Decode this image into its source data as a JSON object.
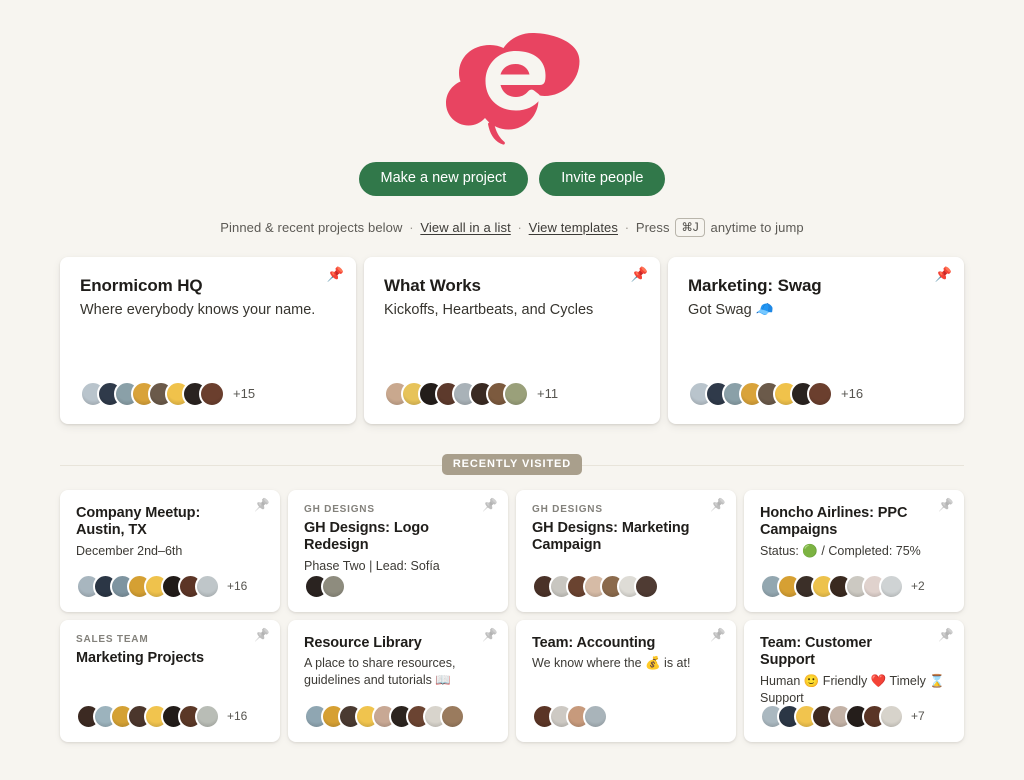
{
  "brand": {
    "logo_icon": "cloud-e-logo",
    "logo_color": "#e84461",
    "accent_green": "#31784a",
    "badge_color": "#a99f8c",
    "background": "#f7f5f0"
  },
  "hero": {
    "primary_button": "Make a new project",
    "secondary_button": "Invite people",
    "subline": {
      "lead": "Pinned & recent projects below",
      "link_list": "View all in a list",
      "link_templates": "View templates",
      "press": "Press",
      "shortcut": "⌘J",
      "tail": "anytime to jump",
      "separator": "·"
    }
  },
  "pinned": {
    "pin_icon": "pushpin-icon",
    "cards": [
      {
        "title": "Enormicom HQ",
        "subtitle": "Where everybody knows your name.",
        "pinned": true,
        "avatar_count": 8,
        "more": "+15",
        "avatar_colors": [
          "#b9c4cc",
          "#2f3a4a",
          "#8aa0a8",
          "#d9a33a",
          "#6b5a4a",
          "#f0c24b",
          "#2a2320",
          "#6b3f2e"
        ]
      },
      {
        "title": "What Works",
        "subtitle": "Kickoffs, Heartbeats, and Cycles",
        "pinned": true,
        "avatar_count": 8,
        "more": "+11",
        "avatar_colors": [
          "#c9a88e",
          "#e7c35a",
          "#231d1a",
          "#5d3a2c",
          "#a9b2b8",
          "#3a2a22",
          "#7c5a3e",
          "#9aa07a"
        ]
      },
      {
        "title": "Marketing: Swag",
        "subtitle": "Got Swag 🧢",
        "pinned": true,
        "avatar_count": 8,
        "more": "+16",
        "avatar_colors": [
          "#b9c4cc",
          "#2f3a4a",
          "#8aa0a8",
          "#d9a33a",
          "#6b5a4a",
          "#f0c24b",
          "#2a2320",
          "#6b3f2e"
        ]
      }
    ]
  },
  "section": {
    "badge": "RECENTLY VISITED"
  },
  "recent": {
    "pin_icon": "pushpin-icon",
    "cards": [
      {
        "eyebrow": "",
        "title": "Company Meetup: Austin, TX",
        "subtitle": "December 2nd–6th",
        "pinned": false,
        "avatar_count": 8,
        "more": "+16",
        "avatar_colors": [
          "#a8b6bf",
          "#2b3645",
          "#7e94a0",
          "#d5a033",
          "#efc24c",
          "#211b18",
          "#5c3526",
          "#bfc6c9"
        ]
      },
      {
        "eyebrow": "GH DESIGNS",
        "title": "GH Designs: Logo Redesign",
        "subtitle": "Phase Two | Lead: Sofía",
        "pinned": false,
        "avatar_count": 2,
        "more": "",
        "avatar_colors": [
          "#2a2320",
          "#8e8c7e"
        ]
      },
      {
        "eyebrow": "GH DESIGNS",
        "title": "GH Designs: Marketing Campaign",
        "subtitle": "",
        "pinned": false,
        "avatar_count": 7,
        "more": "",
        "avatar_colors": [
          "#4a3228",
          "#c8c6c0",
          "#6a4330",
          "#d6bba6",
          "#8b6a4c",
          "#dedcd6",
          "#4f3b33"
        ]
      },
      {
        "eyebrow": "",
        "title": "Honcho Airlines: PPC Campaigns",
        "subtitle": "Status: 🟢 / Completed: 75%",
        "pinned": false,
        "avatar_count": 8,
        "more": "+2",
        "avatar_colors": [
          "#93a7b0",
          "#d6a033",
          "#3b2f28",
          "#edc24c",
          "#3a2a20",
          "#ccc9c2",
          "#e0d2cd",
          "#cfd3d4"
        ]
      },
      {
        "eyebrow": "SALES TEAM",
        "title": "Marketing Projects",
        "subtitle": "",
        "pinned": false,
        "avatar_count": 8,
        "more": "+16",
        "avatar_colors": [
          "#3c2a22",
          "#9cb3bd",
          "#d4a134",
          "#4b362c",
          "#f1c44e",
          "#221c19",
          "#5b3827",
          "#b9bdb6"
        ]
      },
      {
        "eyebrow": "",
        "title": "Resource Library",
        "subtitle": "A place to share resources, guidelines and tutorials 📖",
        "pinned": false,
        "avatar_count": 9,
        "more": "",
        "avatar_colors": [
          "#8fa6b2",
          "#d6a033",
          "#4a3a31",
          "#f0c44e",
          "#c8a894",
          "#2c241f",
          "#6b4432",
          "#d8d4cc",
          "#9a7b5e"
        ]
      },
      {
        "eyebrow": "",
        "title": "Team: Accounting",
        "subtitle": "We know where the 💰 is at!",
        "pinned": false,
        "avatar_count": 4,
        "more": "",
        "avatar_colors": [
          "#5b3526",
          "#cdc9c3",
          "#c79a7c",
          "#a9b4ba"
        ]
      },
      {
        "eyebrow": "",
        "title": "Team: Customer Support",
        "subtitle": "Human 🙂 Friendly ❤️ Timely ⌛ Support",
        "pinned": false,
        "avatar_count": 8,
        "more": "+7",
        "avatar_colors": [
          "#aab8c0",
          "#2b3645",
          "#f1c44e",
          "#3f2a20",
          "#c3b2a6",
          "#251e1b",
          "#5a3526",
          "#d7d3cb"
        ]
      }
    ]
  }
}
